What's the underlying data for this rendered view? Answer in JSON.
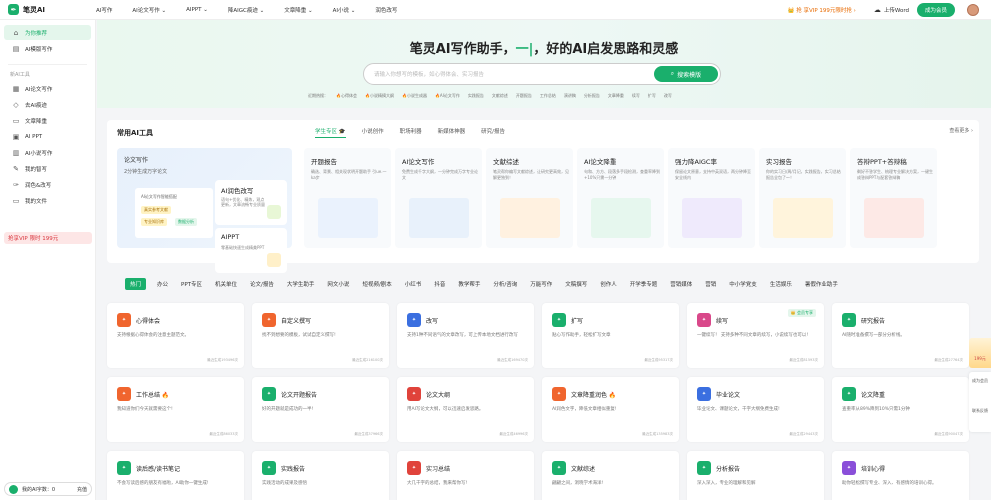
{
  "app": {
    "logo_text": "笔灵AI",
    "logo_icon": "quill-icon"
  },
  "nav": [
    {
      "label": "AI写作"
    },
    {
      "label": "AI论文写作 ⌄"
    },
    {
      "label": "AIPPT ⌄"
    },
    {
      "label": "降AIGC痕迹 ⌄"
    },
    {
      "label": "文章降重 ⌄"
    },
    {
      "label": "AI小说 ⌄"
    },
    {
      "label": "润色改写"
    }
  ],
  "topright": {
    "vip_ad": "👑 抢 享VIP 199元限时抢 ›",
    "upload_label": "上传Word",
    "member_button": "成为会员"
  },
  "sidebar": {
    "items_top": [
      {
        "label": "为你推荐",
        "icon": "home-icon"
      },
      {
        "label": "AI模版写作",
        "icon": "template-icon"
      }
    ],
    "section_label": "新AI工具",
    "items": [
      {
        "label": "AI论文写作",
        "icon": "paper-icon"
      },
      {
        "label": "去AI痕迹",
        "icon": "eraser-icon"
      },
      {
        "label": "文章降重",
        "icon": "doc-icon"
      },
      {
        "label": "AI PPT",
        "icon": "ppt-icon"
      },
      {
        "label": "AI小说写作",
        "icon": "book-icon"
      },
      {
        "label": "我的智写",
        "icon": "pen-icon"
      },
      {
        "label": "润色&改写",
        "icon": "brush-icon"
      },
      {
        "label": "我的文件",
        "icon": "folder-icon"
      }
    ],
    "vip": "抢享VIP 限时 199元",
    "user_name": "我的AI字数：0",
    "user_action": "充值"
  },
  "hero": {
    "title_a": "笔灵AI写作助手，",
    "title_b": "一|",
    "title_c": "，好的AI启发思路和灵感",
    "search_placeholder": "请输入你想写的模板，如心得体会、实习报告",
    "search_button": "搜索模版",
    "tags": [
      "近期热搜：",
      "🔥心得体会",
      "🔥小说精摘大纲",
      "🔥小说生成器",
      "🔥AI论文写作",
      "实践报告",
      "文献综述",
      "开题报告",
      "工作总结",
      "演讲稿",
      "分析报告",
      "文章降重",
      "续写",
      "扩写",
      "改写"
    ]
  },
  "tools": {
    "title": "常用AI工具",
    "tabs": [
      "学生专区 🎓",
      "小说创作",
      "职场利器",
      "新媒体神器",
      "研究/报告"
    ],
    "see_all": "查看更多 ›",
    "featured": {
      "title": "论文写作",
      "subtitle": "2分钟生成万字论文",
      "mock_title": "AI论文写作智能搭配",
      "badges": [
        "真实参考文献",
        "专业知识库",
        "数据分析"
      ],
      "side": [
        {
          "title": "AI润色改写",
          "desc": "语句+优化、精炼，观点更新，文章流畅专业质量",
          "icon": "magic-wand-icon"
        },
        {
          "title": "AIPPT",
          "desc": "零基础快速生成精美PPT",
          "icon": "slides-icon"
        }
      ]
    },
    "cards": [
      {
        "title": "开题报告",
        "desc": "确选、背景、相关现状明开题助手 引ue.一ka步",
        "icon": "report-icon"
      },
      {
        "title": "AI论文写作",
        "desc": "免费生成千字大纲，一分钟完成万字专业论文",
        "icon": "paper-icon"
      },
      {
        "title": "文献综述",
        "desc": "笔灵帮你编写文献综述，让研究更高效，见解更独到！",
        "icon": "review-icon"
      },
      {
        "title": "AI论文降重",
        "desc": "句和、方方、段落多手段检测，查重率降到+10%只需一分钟",
        "icon": "dedup-icon"
      },
      {
        "title": "强力降AIGC率",
        "desc": "保留论文原意，支持中英双语，两分钟降至安全线内",
        "icon": "aigc-icon"
      },
      {
        "title": "实习报告",
        "desc": "你的实习日/周/月记，实践报告，实习总结 报告全包了～！",
        "icon": "intern-icon"
      },
      {
        "title": "答辩PPT+答辩稿",
        "desc": "剩好不答学生、梳理专业解决方案，一键生成答辩PPT与配套答辩稿",
        "icon": "defense-icon"
      }
    ]
  },
  "categories": [
    "热门",
    "办公",
    "PPT专区",
    "机关单位",
    "论文/报告",
    "大学生助手",
    "网文小说",
    "短视频/剧本",
    "小红书",
    "抖音",
    "教学帮手",
    "分析/咨询",
    "万能写作",
    "文稿撰写",
    "创作人",
    "开学季专题",
    "营销媒体",
    "营销",
    "中小学党支",
    "生活娱乐",
    "暑假作业助手"
  ],
  "templates": [
    {
      "name": "心得体会",
      "desc": "支持根据心得体会的注意主题范文。",
      "count": "最近生成193496次",
      "icon": "heart-icon",
      "color": "#f0652e"
    },
    {
      "name": "自定义撰写",
      "desc": "找不到想要的模板，试试自定义撰写!",
      "count": "最近生成216100次",
      "icon": "custom-icon",
      "color": "#f0652e"
    },
    {
      "name": "改写",
      "desc": "支持1种不同语气的文章改写，可上传本地文档进行改写",
      "count": "最近生成169470次",
      "icon": "rewrite-icon",
      "color": "#3b6fe0"
    },
    {
      "name": "扩写",
      "desc": "贴心写作助手，轻松扩写文章",
      "count": "最近生成95317次",
      "icon": "expand-icon",
      "color": "#1aaf6c"
    },
    {
      "name": "续写",
      "desc": "一键续写！ 支持多种不同文章的续写，小说续写也可以!",
      "count": "最近生成81593次",
      "icon": "continue-icon",
      "color": "#d9488a",
      "badge": "👑 会员专享"
    },
    {
      "name": "研究报告",
      "desc": "AI随时准备撰写一部分分析线。",
      "count": "最近生成27764次",
      "icon": "research-icon",
      "color": "#1aaf6c"
    },
    {
      "name": "工作总结 🔥",
      "desc": "我知道你们今天就需要这个!",
      "count": "最近生成86033次",
      "icon": "summary-icon",
      "color": "#f0652e"
    },
    {
      "name": "论文开题报告",
      "desc": "好的开题就是成功的一半!",
      "count": "最近生成37966次",
      "icon": "proposal-icon",
      "color": "#1aaf6c"
    },
    {
      "name": "论文大纲",
      "desc": "用AI写论文大纲，可以迅速启发思路。",
      "count": "最近生成46996次",
      "icon": "outline-icon",
      "color": "#e0433b"
    },
    {
      "name": "文章降重润色 🔥",
      "desc": "AI润色文字，降低文章相似重复!",
      "count": "最近生成135983次",
      "icon": "polish-icon",
      "color": "#f0652e"
    },
    {
      "name": "毕业论文",
      "desc": "毕业论文、课题论文，千字大纲免费生成!",
      "count": "最近生成29443次",
      "icon": "thesis-icon",
      "color": "#3b6fe0"
    },
    {
      "name": "论文降重",
      "desc": "查重率从89%降到10%只需1分钟",
      "count": "最近生成90047次",
      "icon": "dedup-icon",
      "color": "#1aaf6c"
    },
    {
      "name": "读后感/读书笔记",
      "desc": "不会写读后感的朋友有福啦，AI助你一键生成!",
      "count": "",
      "icon": "book-icon",
      "color": "#1aaf6c"
    },
    {
      "name": "实践报告",
      "desc": "实践活动的成果及感悟",
      "count": "",
      "icon": "practice-icon",
      "color": "#1aaf6c"
    },
    {
      "name": "实习总结",
      "desc": "大几千字的总结，我来帮你写!",
      "count": "",
      "icon": "intern-icon",
      "color": "#e0433b"
    },
    {
      "name": "文献综述",
      "desc": "翩翩之间，洞晓学术海洋!",
      "count": "",
      "icon": "review-icon",
      "color": "#1aaf6c"
    },
    {
      "name": "分析报告",
      "desc": "深入深入，专业的理解和见解",
      "count": "",
      "icon": "analysis-icon",
      "color": "#1aaf6c"
    },
    {
      "name": "培训心得",
      "desc": "助你轻松撰写专业、深入、有感情的培训心得。",
      "count": "",
      "icon": "training-icon",
      "color": "#8a4fd9"
    }
  ],
  "float": {
    "gift": "199元",
    "vip": "成为会员",
    "feedback": "联系反馈"
  }
}
